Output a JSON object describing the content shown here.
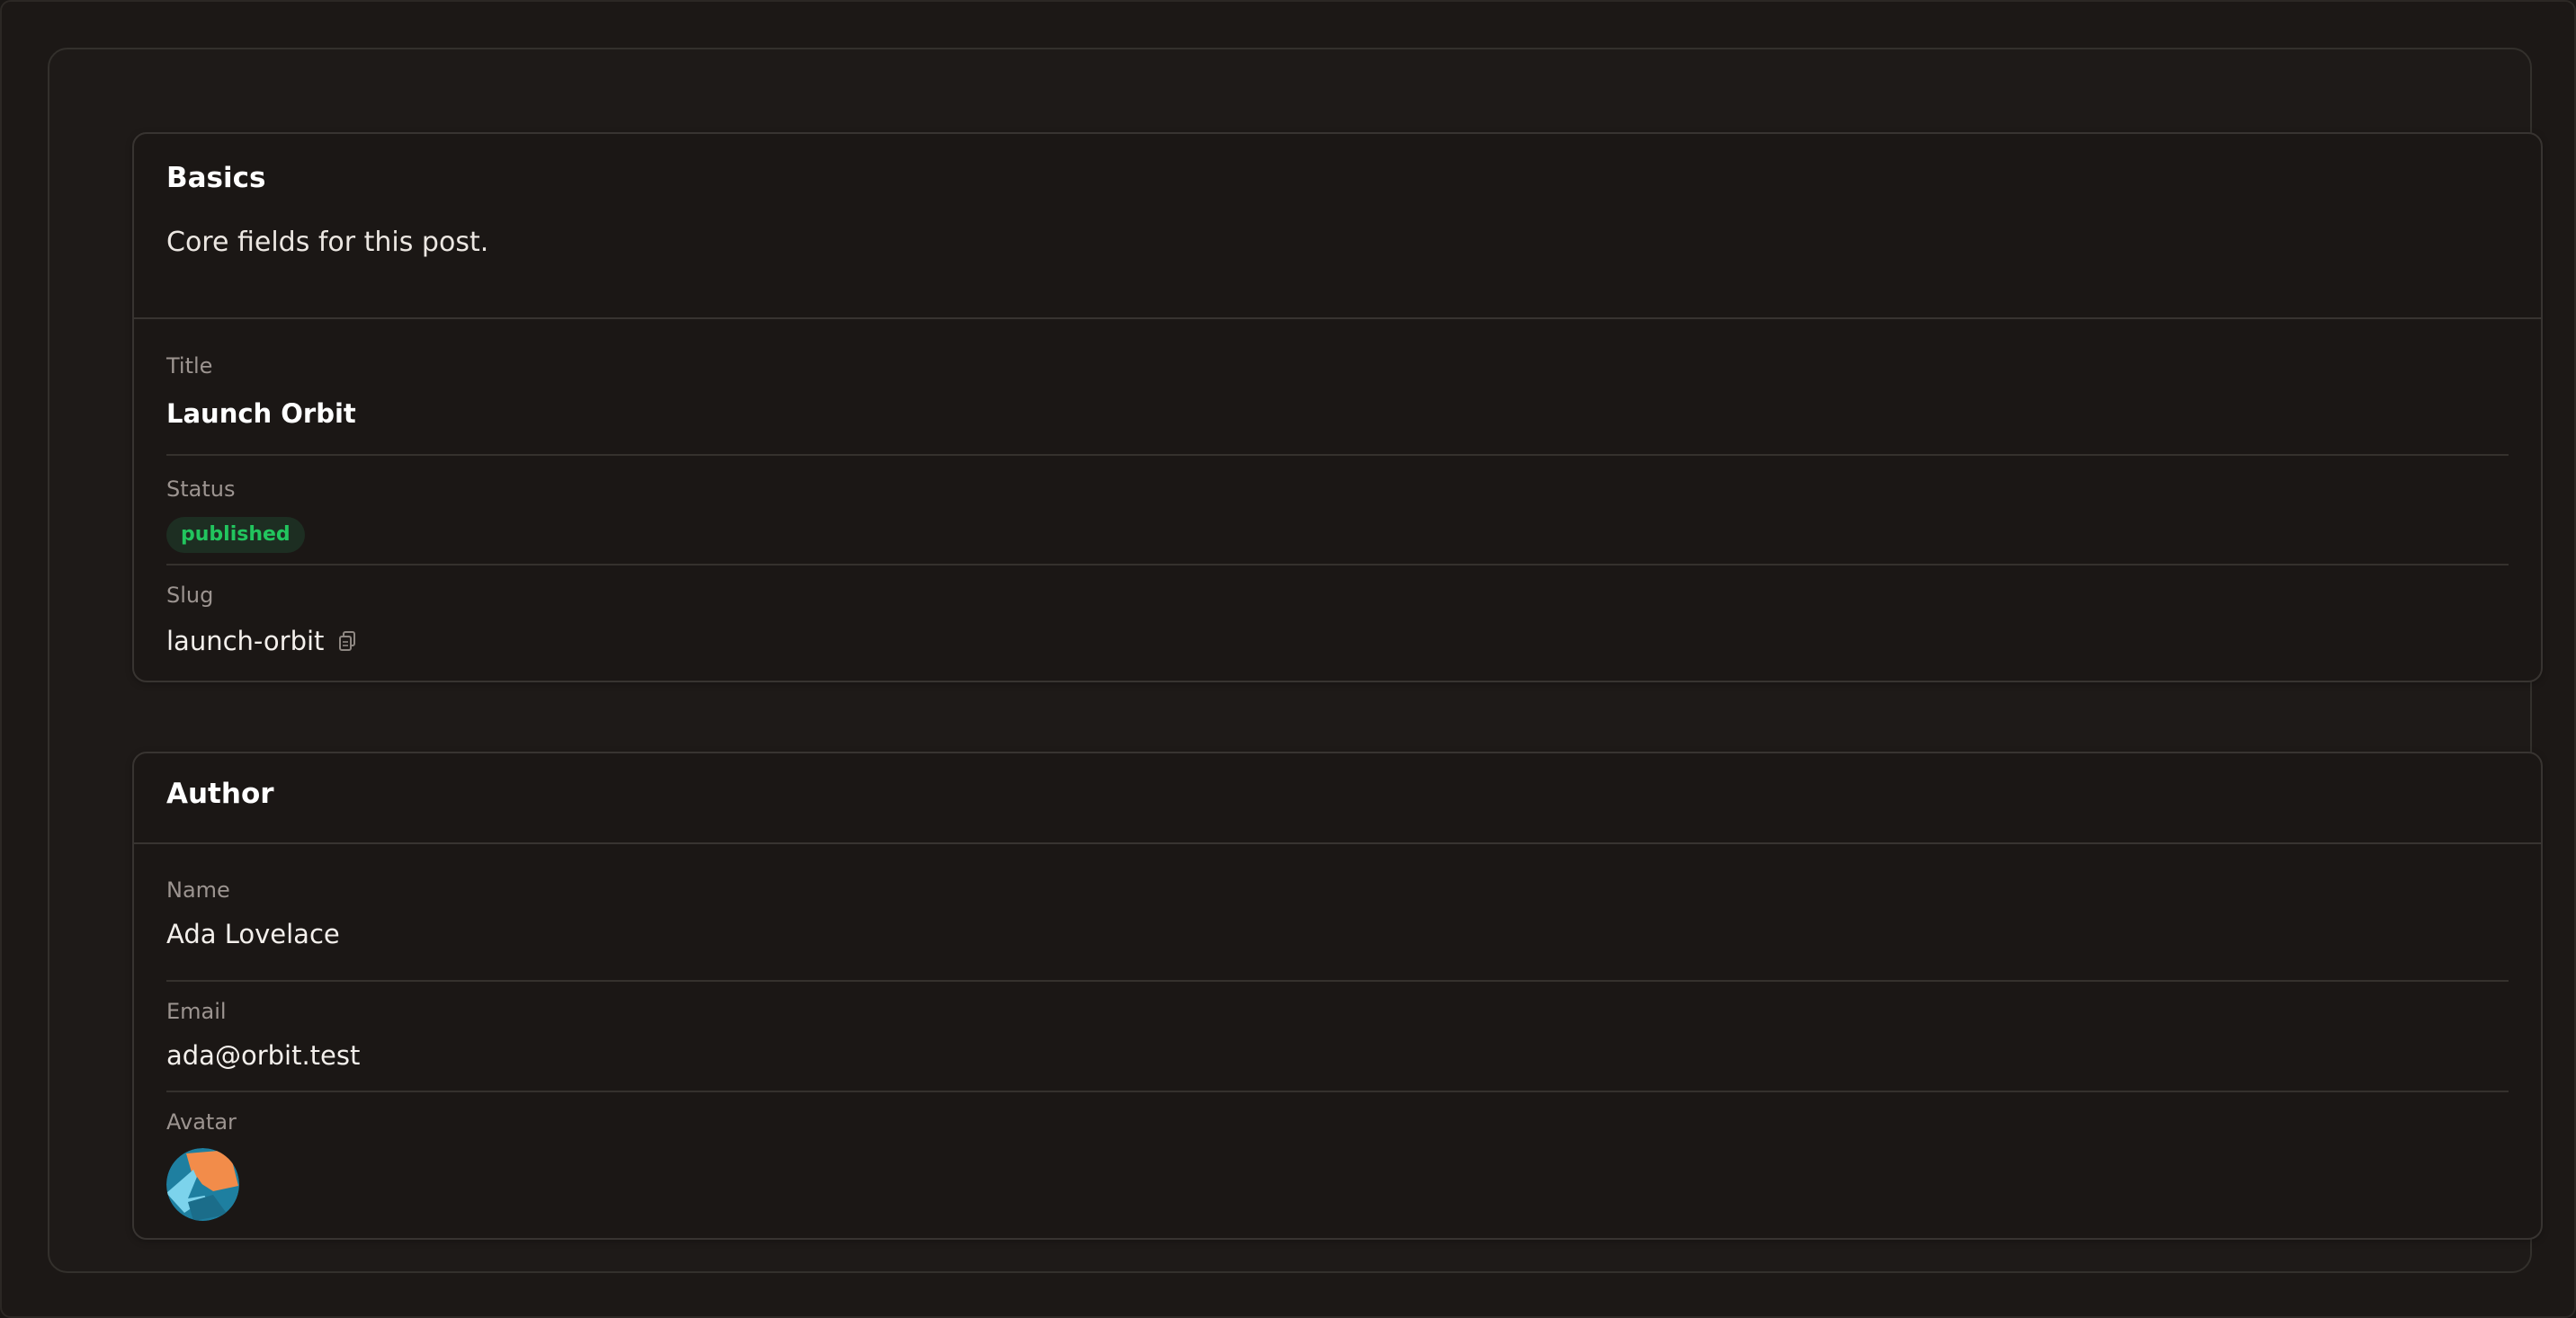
{
  "basics": {
    "title": "Basics",
    "description": "Core fields for this post.",
    "fields": {
      "title_label": "Title",
      "title_value": "Launch Orbit",
      "status_label": "Status",
      "status_value": "published",
      "slug_label": "Slug",
      "slug_value": "launch-orbit"
    },
    "copy_icon": "copy-icon"
  },
  "author": {
    "title": "Author",
    "fields": {
      "name_label": "Name",
      "name_value": "Ada Lovelace",
      "email_label": "Email",
      "email_value": "ada@orbit.test",
      "avatar_label": "Avatar"
    }
  },
  "colors": {
    "background": "#1a1715",
    "card": "#1b1715",
    "border": "#383431",
    "status_published": "#22c55e",
    "avatar_orange": "#f28c4a",
    "avatar_blue": "#1e7fa0",
    "avatar_light_blue": "#7cd3ec"
  }
}
